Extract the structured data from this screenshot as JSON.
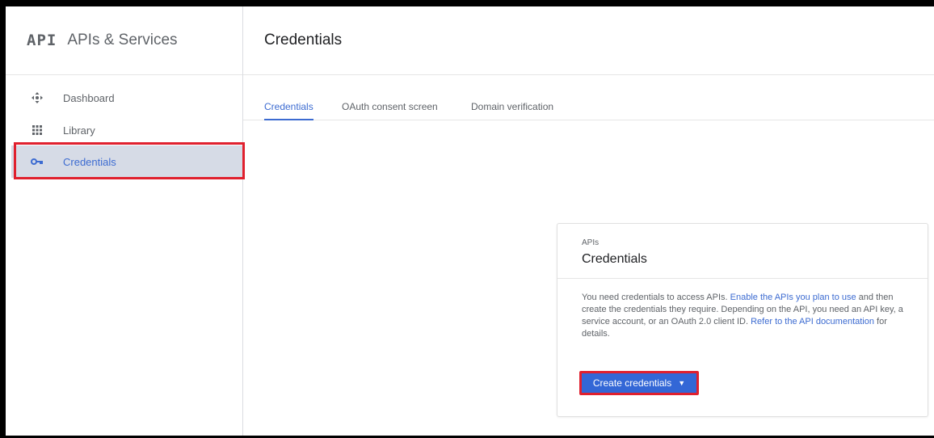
{
  "brand": {
    "logo": "API",
    "name": "APIs & Services"
  },
  "sidebar": {
    "items": [
      {
        "label": "Dashboard",
        "icon": "dashboard-icon"
      },
      {
        "label": "Library",
        "icon": "library-icon"
      },
      {
        "label": "Credentials",
        "icon": "key-icon",
        "active": true
      }
    ]
  },
  "main": {
    "title": "Credentials",
    "tabs": [
      {
        "label": "Credentials",
        "active": true
      },
      {
        "label": "OAuth consent screen"
      },
      {
        "label": "Domain verification"
      }
    ]
  },
  "card": {
    "eyebrow": "APIs",
    "title": "Credentials",
    "text_1": "You need credentials to access APIs. ",
    "link_1": "Enable the APIs you plan to use",
    "text_2": " and then create the credentials they require. Depending on the API, you need an API key, a service account, or an OAuth 2.0 client ID. ",
    "link_2": "Refer to the API documentation",
    "text_3": " for details.",
    "button_label": "Create credentials",
    "button_caret": "▼"
  },
  "colors": {
    "accent": "#3c6bd1",
    "button": "#3367d6",
    "highlight": "#e0202e",
    "active_bg": "#d6dbe6"
  }
}
